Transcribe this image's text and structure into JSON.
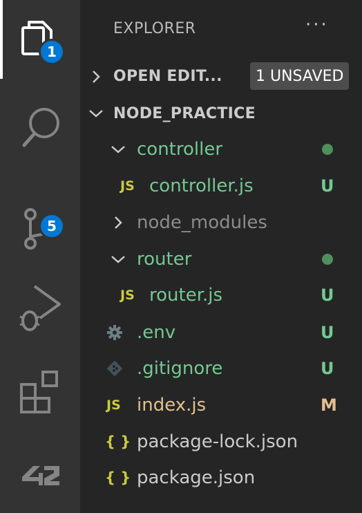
{
  "activity_bar": {
    "explorer_badge": "1",
    "source_control_badge": "5"
  },
  "sidebar": {
    "title": "EXPLORER",
    "more_label": "···",
    "open_editors": {
      "label": "OPEN EDIT...",
      "badge": "1 UNSAVED"
    },
    "project": {
      "label": "NODE_PRACTICE"
    },
    "tree": [
      {
        "label": "controller",
        "type": "folder",
        "expanded": true,
        "status": "dot"
      },
      {
        "label": "controller.js",
        "type": "js",
        "status": "U"
      },
      {
        "label": "node_modules",
        "type": "folder",
        "expanded": false,
        "status": ""
      },
      {
        "label": "router",
        "type": "folder",
        "expanded": true,
        "status": "dot"
      },
      {
        "label": "router.js",
        "type": "js",
        "status": "U"
      },
      {
        "label": ".env",
        "type": "gear",
        "status": "U"
      },
      {
        "label": ".gitignore",
        "type": "git",
        "status": "U"
      },
      {
        "label": "index.js",
        "type": "js",
        "status": "M"
      },
      {
        "label": "package-lock.json",
        "type": "json",
        "status": ""
      },
      {
        "label": "package.json",
        "type": "json",
        "status": ""
      }
    ]
  },
  "icons": {
    "js_glyph": "JS",
    "json_glyph": "{ }"
  },
  "colors": {
    "untracked": "#73c991",
    "modified": "#e2c08d",
    "ignored": "#8c8c8c",
    "badge": "#0078d4"
  }
}
